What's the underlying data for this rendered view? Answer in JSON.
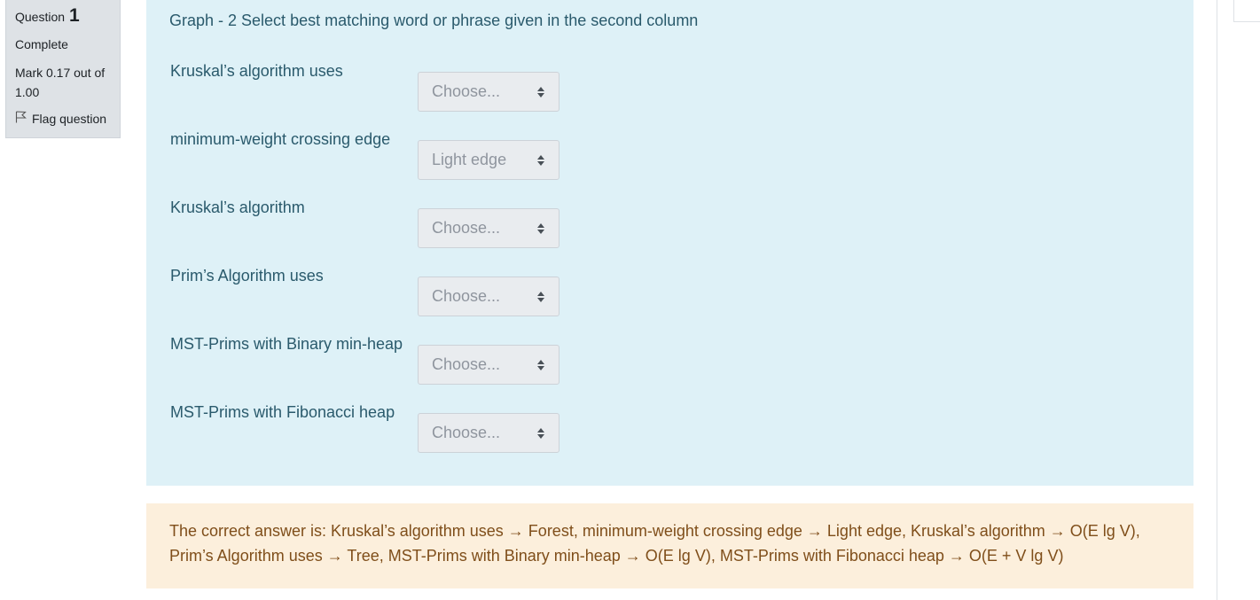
{
  "info": {
    "question_word": "Question",
    "question_number": "1",
    "state": "Complete",
    "grade": "Mark 0.17 out of 1.00",
    "flag_label": "Flag question"
  },
  "question": {
    "text": "Graph - 2 Select best matching word or phrase given in the second column",
    "rows": [
      {
        "label": "Kruskal’s algorithm uses",
        "selected": "Choose..."
      },
      {
        "label": "minimum-weight crossing edge",
        "selected": "Light edge"
      },
      {
        "label": "Kruskal’s algorithm",
        "selected": "Choose..."
      },
      {
        "label": "Prim’s Algorithm uses",
        "selected": "Choose..."
      },
      {
        "label": "MST-Prims with Binary min-heap",
        "selected": "Choose..."
      },
      {
        "label": "MST-Prims with Fibonacci heap",
        "selected": "Choose..."
      }
    ]
  },
  "feedback": {
    "line1": "The correct answer is: Kruskal’s algorithm uses → Forest, minimum-weight crossing edge → Light edge, Kruskal’s algorithm → O(E lg V),",
    "line2": "Prim’s Algorithm uses → Tree, MST-Prims with Binary min-heap → O(E lg V), MST-Prims with Fibonacci heap → O(E + V lg V)"
  },
  "colors": {
    "formulation_bg": "#def1f7",
    "feedback_bg": "#fcefdc",
    "info_bg": "#dee2e6",
    "text_teal": "#2a5a6c",
    "text_brown": "#7f4e1a"
  },
  "icons": {
    "flag": "flag-outline-icon",
    "select_arrows": "sort-arrows-icon"
  }
}
